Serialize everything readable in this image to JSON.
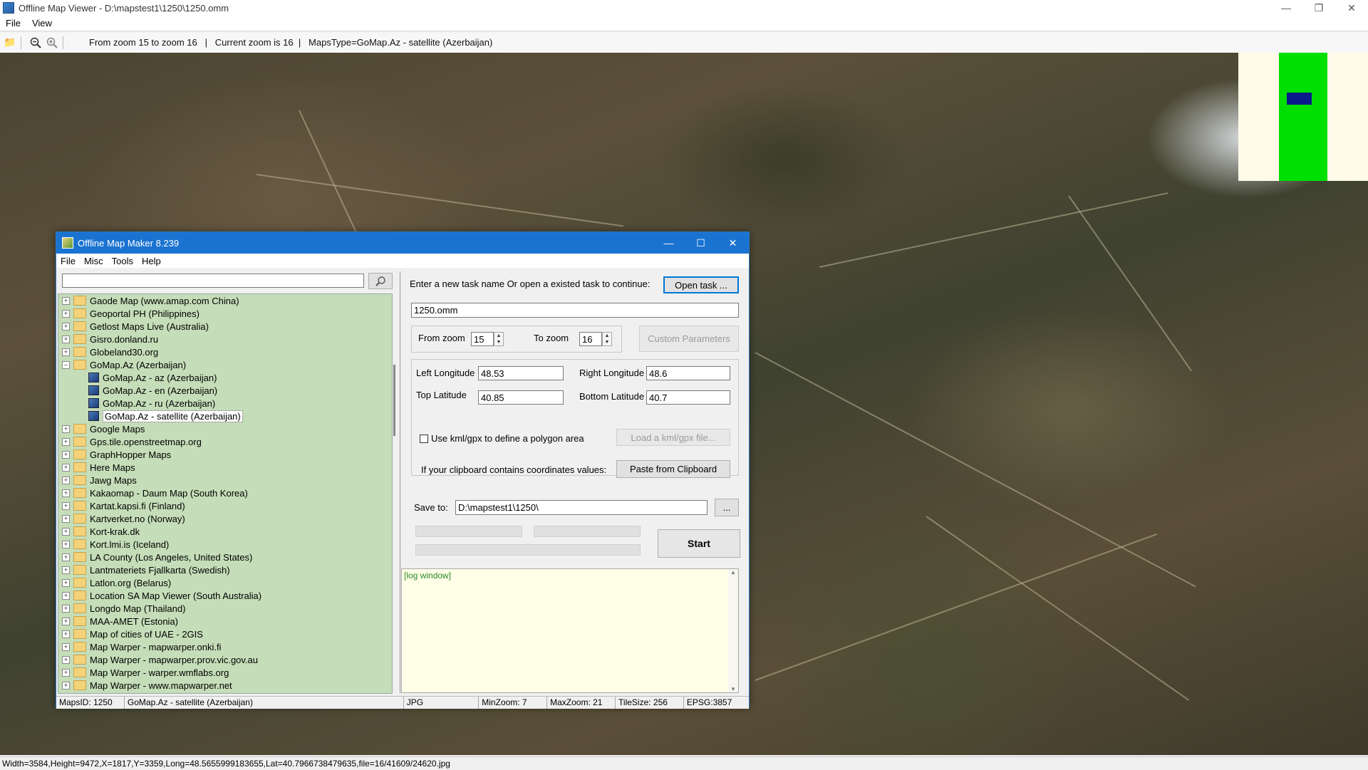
{
  "viewer": {
    "title": "Offline Map Viewer - D:\\mapstest1\\1250\\1250.omm",
    "menu": [
      "File",
      "View"
    ],
    "toolbar_info": "From zoom 15 to zoom 16   |   Current zoom is 16  |   MapsType=GoMap.Az - satellite (Azerbaijan)",
    "status": "Width=3584,Height=9472,X=1817,Y=3359,Long=48.5655999183655,Lat=40.7966738479635,file=16/41609/24620.jpg"
  },
  "minimap": {
    "colors": {
      "background": "#fffbe8",
      "coverage": "#00e000",
      "viewport": "#0a1a8a"
    }
  },
  "dialog": {
    "title": "Offline Map Maker 8.239",
    "menu": [
      "File",
      "Misc",
      "Tools",
      "Help"
    ],
    "search": {
      "value": "",
      "icon": "search-icon"
    },
    "tree": [
      {
        "label": "Gaode Map (www.amap.com China)",
        "expanded": false
      },
      {
        "label": "Geoportal PH (Philippines)",
        "expanded": false
      },
      {
        "label": "Getlost Maps Live (Australia)",
        "expanded": false
      },
      {
        "label": "Gisro.donland.ru",
        "expanded": false
      },
      {
        "label": "Globeland30.org",
        "expanded": false
      },
      {
        "label": "GoMap.Az (Azerbaijan)",
        "expanded": true,
        "children": [
          {
            "label": "GoMap.Az - az (Azerbaijan)"
          },
          {
            "label": "GoMap.Az - en (Azerbaijan)"
          },
          {
            "label": "GoMap.Az - ru (Azerbaijan)"
          },
          {
            "label": "GoMap.Az - satellite (Azerbaijan)",
            "selected": true
          }
        ]
      },
      {
        "label": "Google Maps",
        "expanded": false
      },
      {
        "label": "Gps.tile.openstreetmap.org",
        "expanded": false
      },
      {
        "label": "GraphHopper Maps",
        "expanded": false
      },
      {
        "label": "Here Maps",
        "expanded": false
      },
      {
        "label": "Jawg Maps",
        "expanded": false
      },
      {
        "label": "Kakaomap - Daum Map (South Korea)",
        "expanded": false
      },
      {
        "label": "Kartat.kapsi.fi (Finland)",
        "expanded": false
      },
      {
        "label": "Kartverket.no (Norway)",
        "expanded": false
      },
      {
        "label": "Kort-krak.dk",
        "expanded": false
      },
      {
        "label": "Kort.lmi.is (Iceland)",
        "expanded": false
      },
      {
        "label": "LA County (Los Angeles, United States)",
        "expanded": false
      },
      {
        "label": "Lantmateriets Fjallkarta (Swedish)",
        "expanded": false
      },
      {
        "label": "Latlon.org (Belarus)",
        "expanded": false
      },
      {
        "label": "Location SA Map Viewer (South Australia)",
        "expanded": false
      },
      {
        "label": "Longdo Map (Thailand)",
        "expanded": false
      },
      {
        "label": "MAA-AMET (Estonia)",
        "expanded": false
      },
      {
        "label": "Map of cities of UAE - 2GIS",
        "expanded": false
      },
      {
        "label": "Map Warper - mapwarper.onki.fi",
        "expanded": false
      },
      {
        "label": "Map Warper - mapwarper.prov.vic.gov.au",
        "expanded": false
      },
      {
        "label": "Map Warper - warper.wmflabs.org",
        "expanded": false
      },
      {
        "label": "Map Warper - www.mapwarper.net",
        "expanded": false
      }
    ],
    "task": {
      "prompt": "Enter a new task name Or open a existed task to continue:",
      "open_label": "Open task ...",
      "name_value": "1250.omm"
    },
    "zoom": {
      "from_label": "From zoom",
      "from_value": "15",
      "to_label": "To zoom",
      "to_value": "16",
      "custom_label": "Custom Parameters"
    },
    "coords": {
      "left_lon_label": "Left Longitude",
      "left_lon": "48.53",
      "right_lon_label": "Right Longitude",
      "right_lon": "48.6",
      "top_lat_label": "Top Latitude",
      "top_lat": "40.85",
      "bottom_lat_label": "Bottom Latitude",
      "bottom_lat": "40.7",
      "kml_label": "Use kml/gpx to define a polygon area",
      "kml_button": "Load a kml/gpx file...",
      "clipboard_label": "If your clipboard contains coordinates values:",
      "paste_button": "Paste from Clipboard"
    },
    "save": {
      "label": "Save to:",
      "path": "D:\\mapstest1\\1250\\",
      "browse": "..."
    },
    "start_label": "Start",
    "log_text": "[log window]",
    "status": {
      "maps_id": "MapsID: 1250",
      "maps_name": "GoMap.Az - satellite (Azerbaijan)",
      "format": "JPG",
      "min_zoom": "MinZoom: 7",
      "max_zoom": "MaxZoom: 21",
      "tile_size": "TileSize: 256",
      "epsg": "EPSG:3857"
    }
  }
}
